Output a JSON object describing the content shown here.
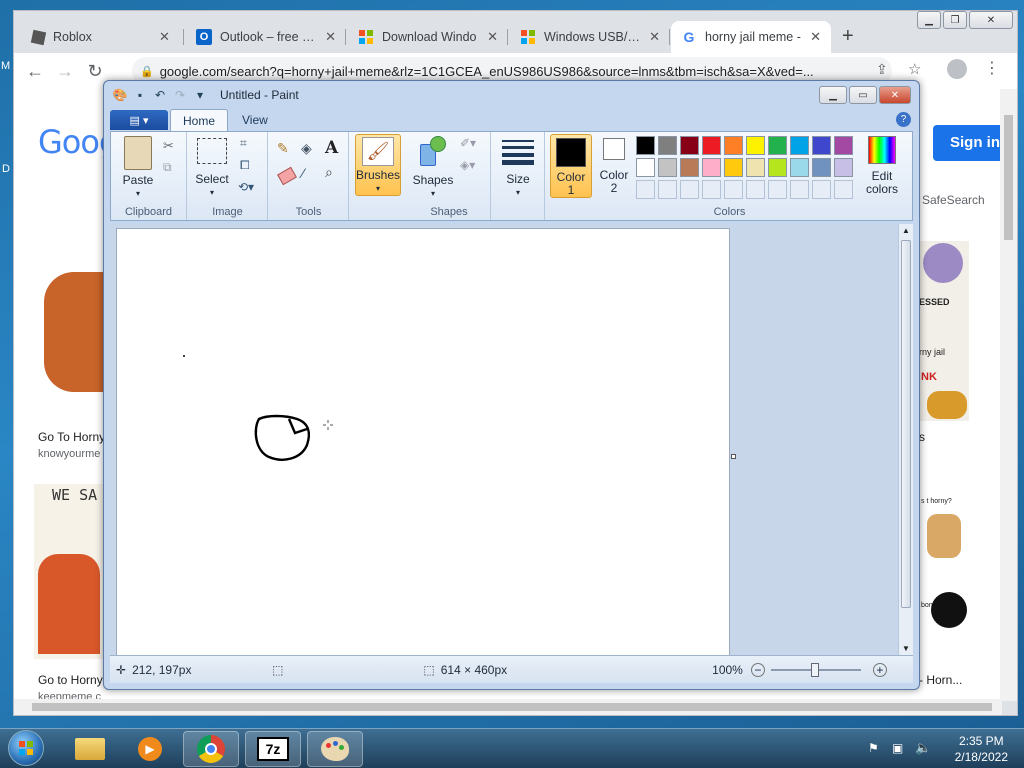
{
  "desktop": {
    "left_letters": [
      "M",
      "D"
    ]
  },
  "chrome": {
    "tabs": [
      {
        "label": "Roblox",
        "icon": "roblox-icon"
      },
      {
        "label": "Outlook – free pers",
        "icon": "outlook-icon"
      },
      {
        "label": "Download Windo",
        "icon": "windows-icon"
      },
      {
        "label": "Windows USB/DV",
        "icon": "windows-icon"
      },
      {
        "label": "horny jail meme -",
        "icon": "google-icon"
      }
    ],
    "new_tab": "+",
    "url": "google.com/search?q=horny+jail+meme&rlz=1C1GCEA_enUS986US986&source=lnms&tbm=isch&sa=X&ved=..."
  },
  "google": {
    "logo": "Goog",
    "sign_in": "Sign in",
    "safesearch": "SafeSearch",
    "results": [
      {
        "title": "Go To Horny",
        "source": "knowyourme"
      },
      {
        "title": "Go to Horny",
        "source": "keepmeme.c"
      }
    ],
    "right_results": [
      {
        "title": "s"
      },
      {
        "title": "- Horn..."
      }
    ],
    "thumb_texts": [
      "WE SA",
      "ESSED",
      "rny jail",
      "NK",
      "s t horny?",
      "bonk"
    ]
  },
  "paint": {
    "title": "Untitled - Paint",
    "tabs": {
      "home": "Home",
      "view": "View"
    },
    "groups": {
      "clipboard": "Clipboard",
      "image": "Image",
      "tools": "Tools",
      "shapes": "Shapes",
      "colors": "Colors"
    },
    "buttons": {
      "paste": "Paste",
      "select": "Select",
      "brushes": "Brushes",
      "shapes": "Shapes",
      "size": "Size",
      "color1": "Color",
      "color1_num": "1",
      "color2": "Color",
      "color2_num": "2",
      "edit_colors_1": "Edit",
      "edit_colors_2": "colors"
    },
    "palette_row1": [
      "#000000",
      "#7f7f7f",
      "#880015",
      "#ed1c24",
      "#ff7f27",
      "#fff200",
      "#22b14c",
      "#00a2e8",
      "#3f48cc",
      "#a349a4"
    ],
    "palette_row2": [
      "#ffffff",
      "#c3c3c3",
      "#b97a57",
      "#ffaec9",
      "#ffc90e",
      "#efe4b0",
      "#b5e61d",
      "#99d9ea",
      "#7092be",
      "#c8bfe7"
    ],
    "color1": "#000000",
    "color2": "#ffffff",
    "status": {
      "cursor": "212, 197px",
      "size": "614 × 460px",
      "zoom": "100%"
    }
  },
  "taskbar": {
    "time": "2:35 PM",
    "date": "2/18/2022",
    "apps": [
      "start-orb",
      "explorer",
      "media-player",
      "chrome",
      "7zip",
      "paint"
    ],
    "sevenzip_label": "7z"
  }
}
